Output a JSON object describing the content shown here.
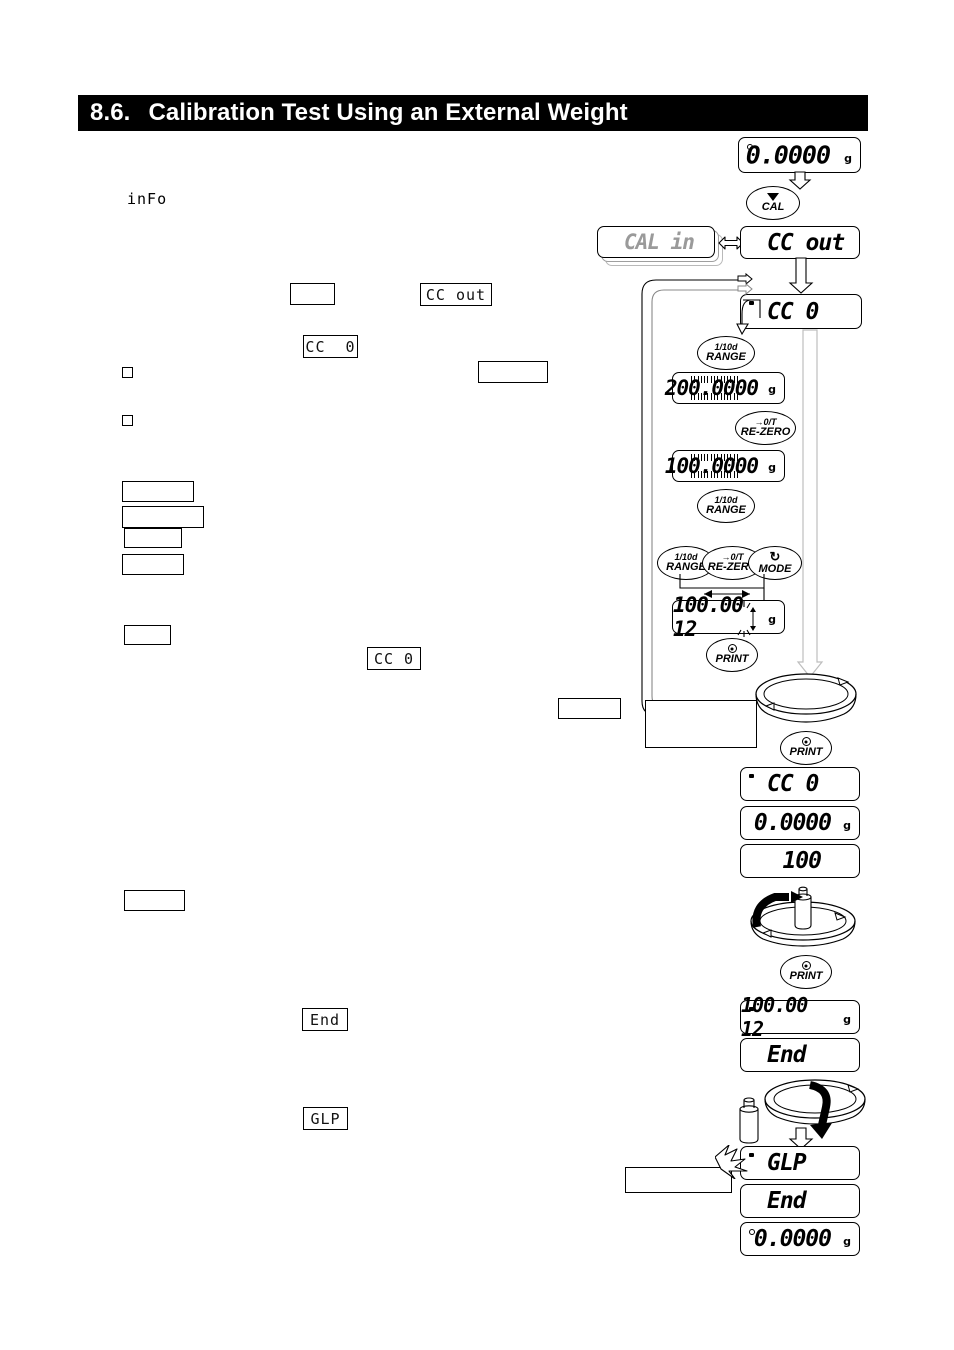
{
  "document": {
    "section_number": "8.6.",
    "section_title": "Calibration Test Using an External Weight"
  },
  "body_column": {
    "info_text": "inFo",
    "codes": {
      "cc_out": "CC out",
      "cc_0_a": "CC  0",
      "cc_0_b": "CC 0",
      "end": "End",
      "glp": "GLP"
    },
    "blank_boxes_note": ""
  },
  "flowchart": {
    "displays": [
      {
        "id": "d1",
        "value": "0.0000",
        "unit": "g",
        "indicator": "zero-circle"
      },
      {
        "id": "d2",
        "value": "CAL  in",
        "unit": "",
        "indicator": "none"
      },
      {
        "id": "d3",
        "value": "CC  out",
        "unit": "",
        "indicator": "none"
      },
      {
        "id": "d4",
        "value": "CC      0",
        "unit": "",
        "indicator": "stable-mark"
      },
      {
        "id": "d5",
        "value": "200.0000",
        "unit": "g",
        "indicator": "bargraph"
      },
      {
        "id": "d6",
        "value": "100.0000",
        "unit": "g",
        "indicator": "bargraph"
      },
      {
        "id": "d7",
        "value": "100.00 12",
        "unit": "g",
        "indicator": "blink"
      },
      {
        "id": "d8",
        "value": "CC      0",
        "unit": "",
        "indicator": "stable-mark"
      },
      {
        "id": "d9",
        "value": "0.0000",
        "unit": "g",
        "indicator": "none"
      },
      {
        "id": "d10",
        "value": "100",
        "unit": "",
        "indicator": "none"
      },
      {
        "id": "d11",
        "value": "100.00 12",
        "unit": "g",
        "indicator": "stable-mark"
      },
      {
        "id": "d12",
        "value": "End",
        "unit": "",
        "indicator": "none"
      },
      {
        "id": "d13",
        "value": "GLP",
        "unit": "",
        "indicator": "stable-mark"
      },
      {
        "id": "d14",
        "value": "End",
        "unit": "",
        "indicator": "none"
      },
      {
        "id": "d15",
        "value": "0.0000",
        "unit": "g",
        "indicator": "zero-circle"
      }
    ],
    "keys": [
      {
        "id": "k_cal",
        "line1": "",
        "line2": "CAL",
        "glyph": "triangle-down"
      },
      {
        "id": "k_range_1",
        "line1": "1/10d",
        "line2": "RANGE",
        "glyph": "none"
      },
      {
        "id": "k_rezero_1",
        "line1": "→0/T",
        "line2": "RE-ZERO",
        "glyph": "none"
      },
      {
        "id": "k_range_2",
        "line1": "1/10d",
        "line2": "RANGE",
        "glyph": "none"
      },
      {
        "id": "k_range_3",
        "line1": "1/10d",
        "line2": "RANGE",
        "glyph": "none"
      },
      {
        "id": "k_rezero_2",
        "line1": "→0/T",
        "line2": "RE-ZERO",
        "glyph": "none"
      },
      {
        "id": "k_mode",
        "line1": "",
        "line2": "MODE",
        "glyph": "recycle"
      },
      {
        "id": "k_print_1",
        "line1": "",
        "line2": "PRINT",
        "glyph": "print"
      },
      {
        "id": "k_print_2",
        "line1": "",
        "line2": "PRINT",
        "glyph": "print"
      },
      {
        "id": "k_print_3",
        "line1": "",
        "line2": "PRINT",
        "glyph": "print"
      }
    ],
    "colors": {
      "ink": "#000000",
      "paper": "#ffffff",
      "gray_arrow": "#b5b5b5",
      "gray_text": "#9a9a9a"
    }
  }
}
